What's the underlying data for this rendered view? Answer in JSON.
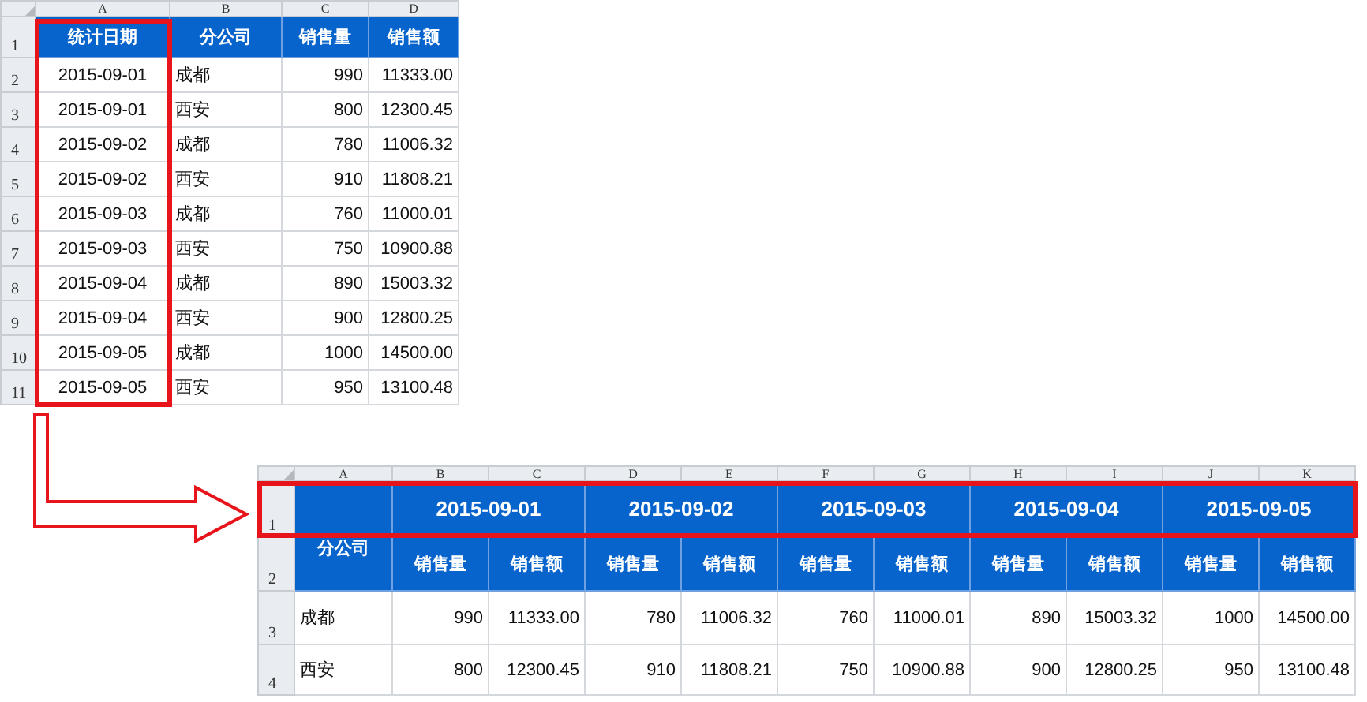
{
  "source_sheet": {
    "column_letters": [
      "A",
      "B",
      "C",
      "D"
    ],
    "header": [
      "统计日期",
      "分公司",
      "销售量",
      "销售额"
    ],
    "rows": [
      {
        "row_number": "1",
        "kind": "header"
      },
      {
        "row_number": "2",
        "cells": [
          "2015-09-01",
          "成都",
          "990",
          "11333.00"
        ]
      },
      {
        "row_number": "3",
        "cells": [
          "2015-09-01",
          "西安",
          "800",
          "12300.45"
        ]
      },
      {
        "row_number": "4",
        "cells": [
          "2015-09-02",
          "成都",
          "780",
          "11006.32"
        ]
      },
      {
        "row_number": "5",
        "cells": [
          "2015-09-02",
          "西安",
          "910",
          "11808.21"
        ]
      },
      {
        "row_number": "6",
        "cells": [
          "2015-09-03",
          "成都",
          "760",
          "11000.01"
        ]
      },
      {
        "row_number": "7",
        "cells": [
          "2015-09-03",
          "西安",
          "750",
          "10900.88"
        ]
      },
      {
        "row_number": "8",
        "cells": [
          "2015-09-04",
          "成都",
          "890",
          "15003.32"
        ]
      },
      {
        "row_number": "9",
        "cells": [
          "2015-09-04",
          "西安",
          "900",
          "12800.25"
        ]
      },
      {
        "row_number": "10",
        "cells": [
          "2015-09-05",
          "成都",
          "1000",
          "14500.00"
        ]
      },
      {
        "row_number": "11",
        "cells": [
          "2015-09-05",
          "西安",
          "950",
          "13100.48"
        ]
      }
    ]
  },
  "result_sheet": {
    "column_letters": [
      "A",
      "B",
      "C",
      "D",
      "E",
      "F",
      "G",
      "H",
      "I",
      "J",
      "K"
    ],
    "row_numbers": [
      "1",
      "2",
      "3",
      "4"
    ],
    "corner_header": "分公司",
    "dates": [
      "2015-09-01",
      "2015-09-02",
      "2015-09-03",
      "2015-09-04",
      "2015-09-05"
    ],
    "subheaders": [
      "销售量",
      "销售额",
      "销售量",
      "销售额",
      "销售量",
      "销售额",
      "销售量",
      "销售额",
      "销售量",
      "销售额"
    ],
    "rows": [
      {
        "branch": "成都",
        "values": [
          "990",
          "11333.00",
          "780",
          "11006.32",
          "760",
          "11000.01",
          "890",
          "15003.32",
          "1000",
          "14500.00"
        ]
      },
      {
        "branch": "西安",
        "values": [
          "800",
          "12300.45",
          "910",
          "11808.21",
          "750",
          "10900.88",
          "900",
          "12800.25",
          "950",
          "13100.48"
        ]
      }
    ]
  }
}
